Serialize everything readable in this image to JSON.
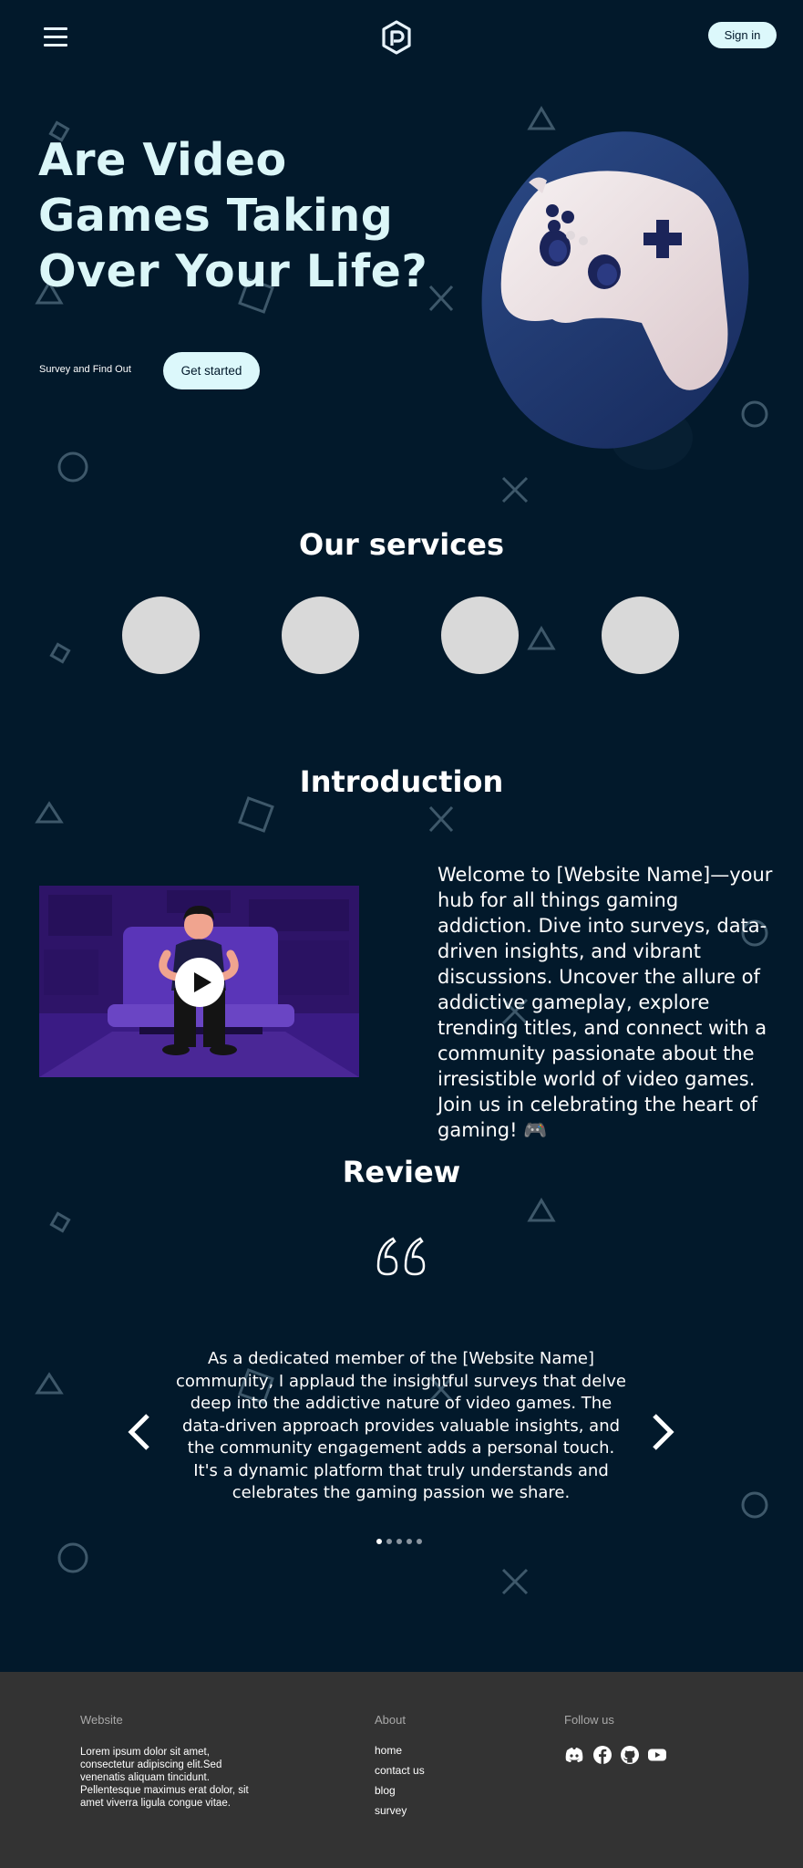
{
  "header": {
    "menu_icon": "hamburger-menu-icon",
    "logo_icon": "hexagon-p-logo",
    "signin_label": "Sign in"
  },
  "hero": {
    "title": "Are Video Games Taking Over Your Life?",
    "subtitle": "Survey and Find Out",
    "cta_label": "Get started",
    "image": "game-controller-illustration"
  },
  "services": {
    "title": "Our services",
    "items": [
      {
        "icon": "service-placeholder"
      },
      {
        "icon": "service-placeholder"
      },
      {
        "icon": "service-placeholder"
      },
      {
        "icon": "service-placeholder"
      }
    ]
  },
  "intro": {
    "title": "Introduction",
    "video_thumbnail": "gamer-on-couch-illustration",
    "play_icon": "play-icon",
    "text": "Welcome to [Website Name]—your hub for all things gaming addiction. Dive into surveys, data-driven insights, and vibrant discussions. Uncover the allure of addictive gameplay, explore trending titles, and connect with a community passionate about the irresistible world of video games. Join us in celebrating the heart of gaming! 🎮"
  },
  "review": {
    "title": "Review",
    "quote_icon": "quote-icon",
    "text": "As a dedicated member of the [Website Name] community, I applaud the insightful surveys that delve deep into the addictive nature of video games. The data-driven approach provides valuable insights, and the community engagement adds a personal touch. It's a dynamic platform that truly understands and celebrates the gaming passion we share.",
    "prev_icon": "chevron-left-icon",
    "next_icon": "chevron-right-icon",
    "slide_count": 5,
    "active_slide": 1
  },
  "footer": {
    "website_heading": "Website",
    "website_text": "Lorem ipsum dolor sit amet, consectetur adipiscing elit.Sed venenatis aliquam tincidunt. Pellentesque maximus erat dolor, sit amet viverra ligula congue vitae.",
    "about_heading": "About",
    "about_links": [
      "home",
      "contact us",
      "blog",
      "survey"
    ],
    "follow_heading": "Follow us",
    "social_icons": [
      "discord-icon",
      "facebook-icon",
      "github-icon",
      "youtube-icon"
    ]
  },
  "colors": {
    "background": "#02192b",
    "accent": "#dcf8fb",
    "footer": "#333333",
    "decor": "#4a6577"
  }
}
